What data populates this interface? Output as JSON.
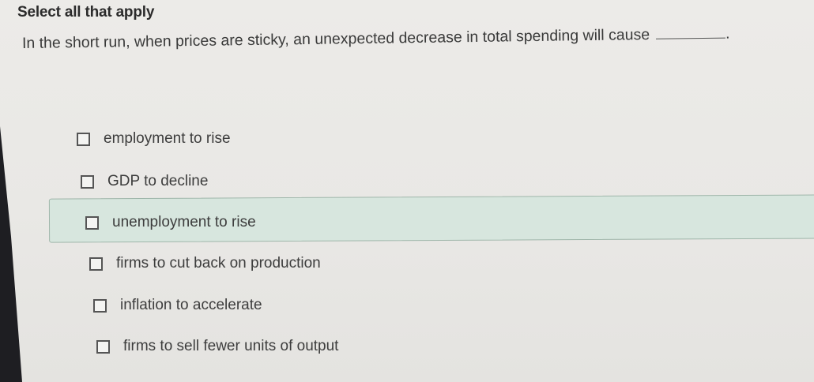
{
  "instruction": "Select all that apply",
  "question": {
    "text": "In the short run, when prices are sticky, an unexpected decrease in total spending will cause",
    "blank_suffix": "."
  },
  "options": [
    {
      "label": "employment to rise",
      "checked": false
    },
    {
      "label": "GDP to decline",
      "checked": false
    },
    {
      "label": "unemployment to rise",
      "checked": false,
      "highlighted": true
    },
    {
      "label": "firms to cut back on production",
      "checked": false
    },
    {
      "label": "inflation to accelerate",
      "checked": false
    },
    {
      "label": "firms to sell fewer units of output",
      "checked": false
    }
  ],
  "colors": {
    "highlight": "#d7e6de",
    "background": "#ecebe8"
  }
}
